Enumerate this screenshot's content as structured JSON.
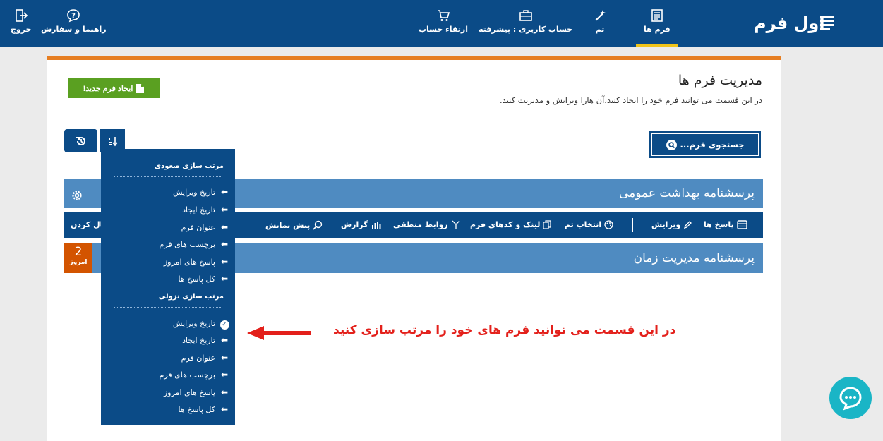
{
  "brand": {
    "logo_text": "اول فرم"
  },
  "nav": {
    "forms": "فرم ها",
    "theme": "تم",
    "account": "حساب کاربری : پیشرفته",
    "upgrade": "ارتقاء حساب",
    "help": "راهنما و سفارش",
    "logout": "خروج"
  },
  "page": {
    "title": "مدیریت فرم ها",
    "subtitle": "در این قسمت می توانید فرم خود را ایجاد کنید،آن هارا ویرایش و مدیریت کنید.",
    "create_button": "ایجاد فرم جدید!",
    "search_button": "جستجوی فرم..."
  },
  "forms": [
    {
      "title": "پرسشنامه بهداشت عمومی"
    },
    {
      "title": "پرسشنامه مدیریت زمان"
    }
  ],
  "toolbar": {
    "responses": "پاسخ ها",
    "edit": "ویرایش",
    "theme_select": "انتخاب تم",
    "link_codes": "لینک و کدهای فرم",
    "logic": "روابط منطقی",
    "report": "گزارش",
    "preview": "پیش نمایش",
    "activate_partial": "عال کردن"
  },
  "today_badge": {
    "count": "2",
    "label": "امروز"
  },
  "sort_menu": {
    "ascending_heading": "مرتب سازی صعودی",
    "descending_heading": "مرتب سازی نزولی",
    "ascending_items": [
      "تاریخ ویرایش",
      "تاریخ ایجاد",
      "عنوان فرم",
      "برچسب های فرم",
      "پاسخ های امروز",
      "کل پاسخ ها"
    ],
    "descending_items": [
      "تاریخ ویرایش",
      "تاریخ ایجاد",
      "عنوان فرم",
      "برچسب های فرم",
      "پاسخ های امروز",
      "کل پاسخ ها"
    ],
    "selected": "descending:تاریخ ویرایش"
  },
  "annotation": "در این قسمت می توانید فرم های خود را مرتب سازی کنید",
  "colors": {
    "primary": "#0b4b87",
    "header_row": "#4f8bc1",
    "accent": "#e67e22",
    "create": "#5aa021",
    "annotation": "#e3201b",
    "chat": "#1ab5c6"
  }
}
